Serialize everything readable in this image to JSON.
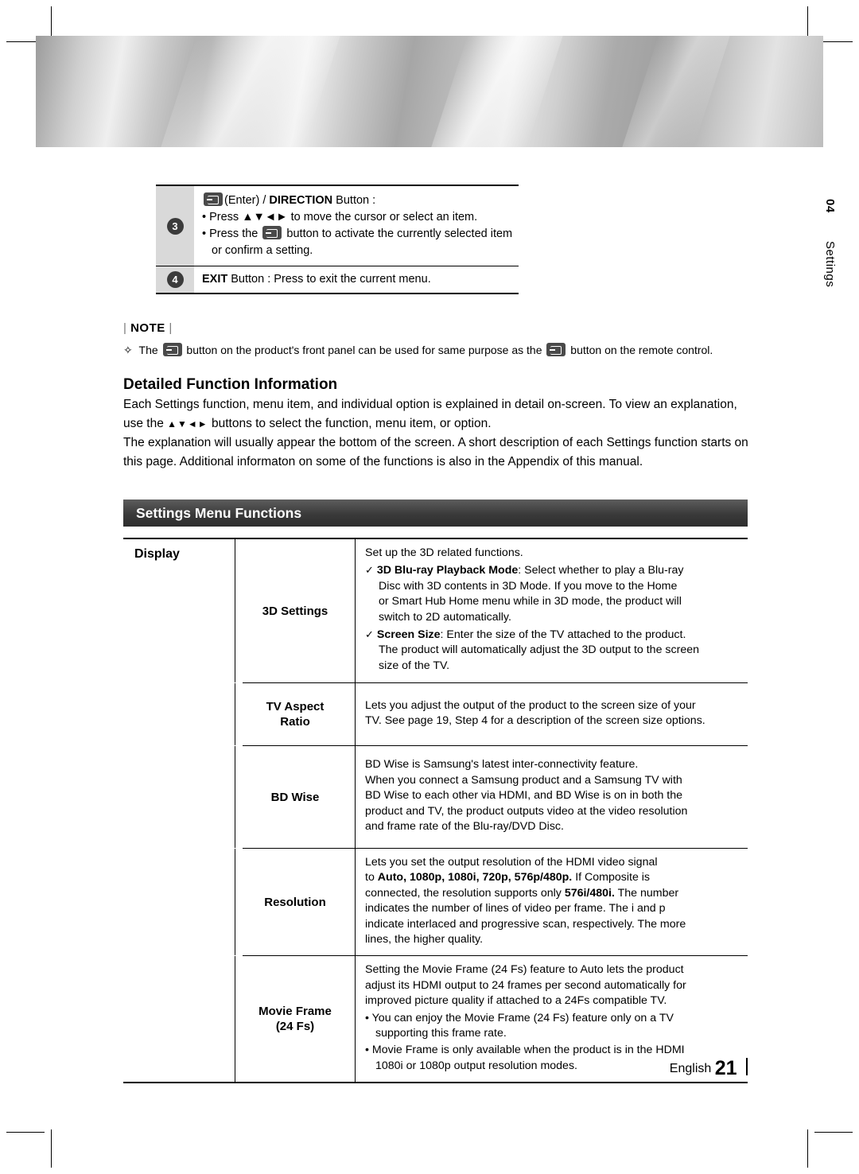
{
  "side": {
    "chapter": "04",
    "name": "Settings"
  },
  "top_table": {
    "rows": [
      {
        "num": "3",
        "title_prefix": "(Enter) / ",
        "title_strong": "DIRECTION",
        "title_suffix": " Button :",
        "lines": [
          "• Press ▲▼◄► to move the cursor or select an item.",
          "• Press the       button to activate the currently selected item",
          "  or confirm a setting."
        ]
      },
      {
        "num": "4",
        "text_strong": "EXIT",
        "text": " Button : Press to exit the current menu."
      }
    ]
  },
  "note": {
    "label": "NOTE",
    "text_a": "The",
    "text_b": "button on the product's front panel can be used for same purpose as the",
    "text_c": "button on the remote control."
  },
  "detailed": {
    "heading": "Detailed Function Information",
    "paragraph": "Each Settings function, menu item, and individual option is explained in detail on-screen. To view an explanation, use the ▲▼◄► buttons to select the function, menu item, or option.\nThe explanation will usually appear the bottom of the screen. A short description of each Settings function starts on this page. Additional informaton on some of the functions is also in the Appendix of this manual."
  },
  "section": {
    "title": "Settings Menu Functions"
  },
  "table": {
    "group_label": "Display",
    "rows": [
      {
        "name": "3D Settings",
        "body": [
          {
            "type": "plain",
            "text": "Set up the 3D related functions."
          },
          {
            "type": "check",
            "bold": "3D Blu-ray Playback Mode",
            "text": ": Select whether to play a Blu-ray Disc with 3D contents in 3D Mode. If you move to the Home or Smart Hub Home menu while in 3D mode, the product will switch to 2D automatically."
          },
          {
            "type": "check",
            "bold": "Screen Size",
            "text": ": Enter the size of the TV attached to the product. The product will automatically adjust the 3D output to the screen size of the TV."
          }
        ]
      },
      {
        "name": "TV Aspect\nRatio",
        "body": [
          {
            "type": "plain",
            "text": "Lets you adjust the output of the product to the screen size of your TV. See page 19, Step 4 for a description of the screen size options."
          }
        ]
      },
      {
        "name": "BD Wise",
        "body": [
          {
            "type": "plain",
            "text": "BD Wise is Samsung's latest inter-connectivity feature."
          },
          {
            "type": "plain",
            "text": "When you connect a Samsung product and a Samsung TV with BD Wise to each other via HDMI, and BD Wise is on in both the product and TV, the product outputs video at the video resolution and frame rate of the Blu-ray/DVD Disc."
          }
        ]
      },
      {
        "name": "Resolution",
        "body": [
          {
            "type": "mixed",
            "segments": [
              {
                "t": "Lets you set the output resolution of the HDMI video signal to ",
                "b": false
              },
              {
                "t": "Auto, 1080p, 1080i, 720p, 576p/480p.",
                "b": true
              },
              {
                "t": " If Composite is connected, the resolution supports only ",
                "b": false
              },
              {
                "t": "576i/480i.",
                "b": true
              },
              {
                "t": " The number indicates the number of lines of video per frame. The i and p indicate interlaced and progressive scan, respectively. The more lines, the higher quality.",
                "b": false
              }
            ]
          }
        ]
      },
      {
        "name": "Movie Frame\n(24 Fs)",
        "body": [
          {
            "type": "plain",
            "text": "Setting the Movie Frame (24 Fs) feature to Auto lets the product adjust its HDMI output to 24 frames per second automatically for improved picture quality if attached to a 24Fs compatible TV."
          },
          {
            "type": "bullet",
            "text": "You can enjoy the Movie Frame (24 Fs) feature only on a TV supporting this frame rate."
          },
          {
            "type": "bullet",
            "text": "Movie Frame is only available when the product is in the HDMI 1080i or 1080p output resolution modes."
          }
        ]
      }
    ]
  },
  "footer": {
    "language": "English",
    "page": "21"
  }
}
